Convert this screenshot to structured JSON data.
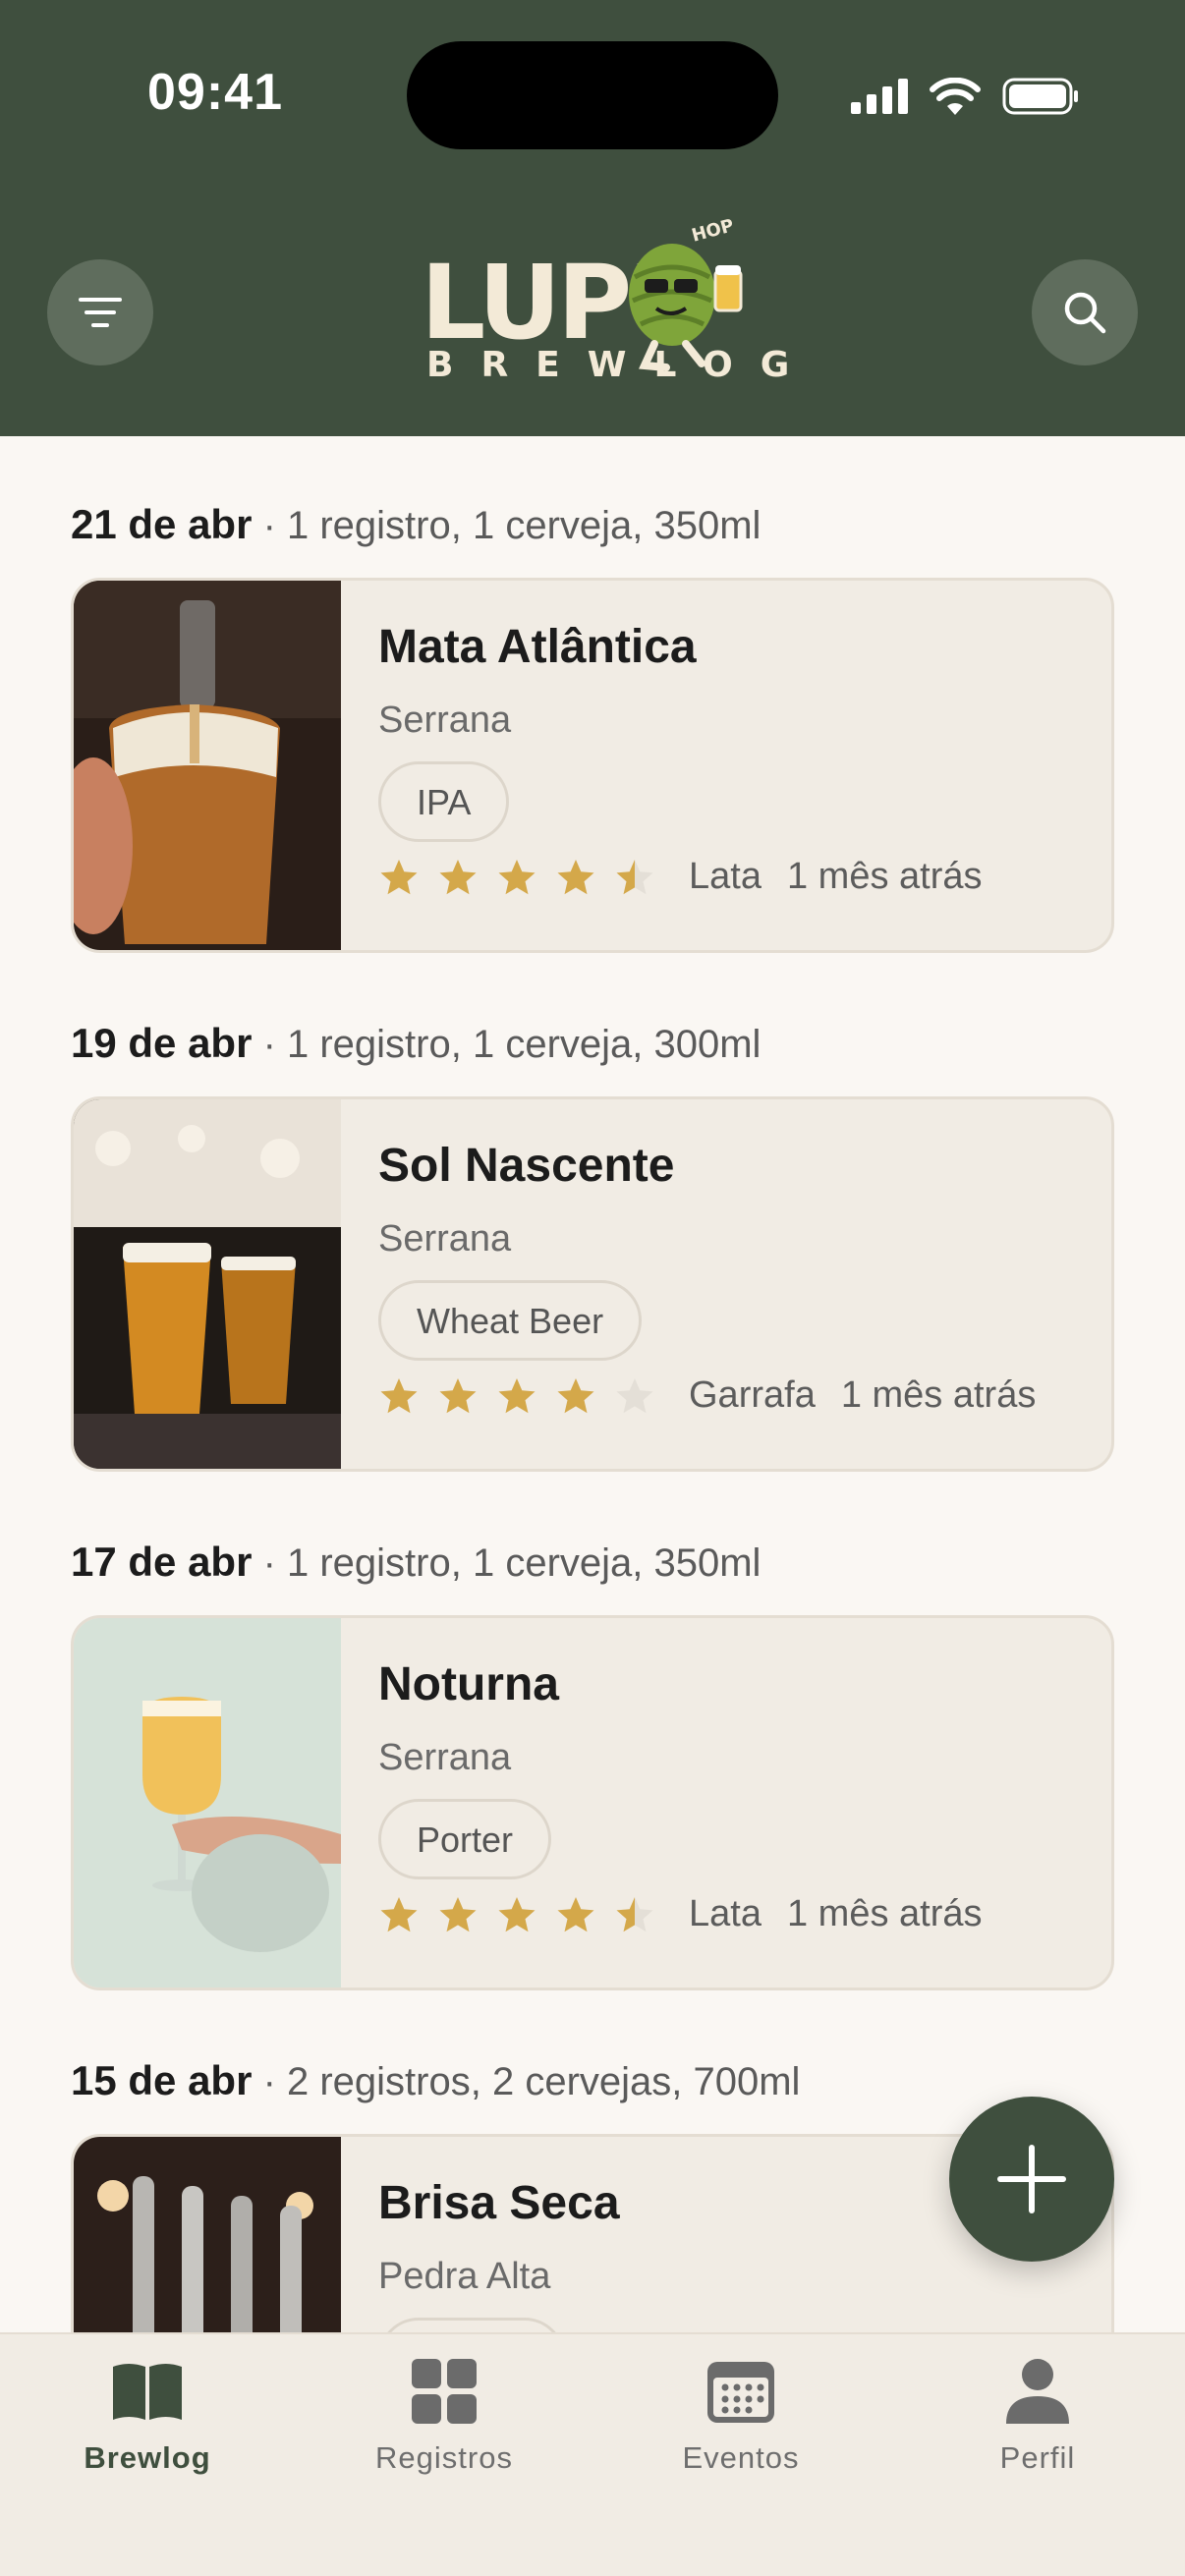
{
  "status_bar": {
    "time": "09:41"
  },
  "header": {
    "logo_word": "LUPU",
    "logo_sub": "BREWLOG",
    "logo_hop": "HOP"
  },
  "days": [
    {
      "date": "21 de abr",
      "summary": "· 1 registro, 1 cerveja, 350ml",
      "entry": {
        "name": "Mata Atlântica",
        "brewery": "Serrana",
        "style": "IPA",
        "rating": 4.5,
        "format": "Lata",
        "time_ago": "1 mês atrás"
      }
    },
    {
      "date": "19 de abr",
      "summary": "· 1 registro, 1 cerveja, 300ml",
      "entry": {
        "name": "Sol Nascente",
        "brewery": "Serrana",
        "style": "Wheat Beer",
        "rating": 4,
        "format": "Garrafa",
        "time_ago": "1 mês atrás"
      }
    },
    {
      "date": "17 de abr",
      "summary": "· 1 registro, 1 cerveja, 350ml",
      "entry": {
        "name": "Noturna",
        "brewery": "Serrana",
        "style": "Porter",
        "rating": 4.5,
        "format": "Lata",
        "time_ago": "1 mês atrás"
      }
    },
    {
      "date": "15 de abr",
      "summary": "· 2 registros, 2 cervejas, 700ml",
      "entry": {
        "name": "Brisa Seca",
        "brewery": "Pedra Alta"
      }
    }
  ],
  "tabs": [
    {
      "label": "Brewlog",
      "icon": "book-icon",
      "active": true
    },
    {
      "label": "Registros",
      "icon": "grid-icon",
      "active": false
    },
    {
      "label": "Eventos",
      "icon": "calendar-icon",
      "active": false
    },
    {
      "label": "Perfil",
      "icon": "person-icon",
      "active": false
    }
  ],
  "colors": {
    "brand": "#3f4f3e",
    "star": "#d4a84a",
    "background": "#faf7f3",
    "card": "#f1ece4"
  }
}
